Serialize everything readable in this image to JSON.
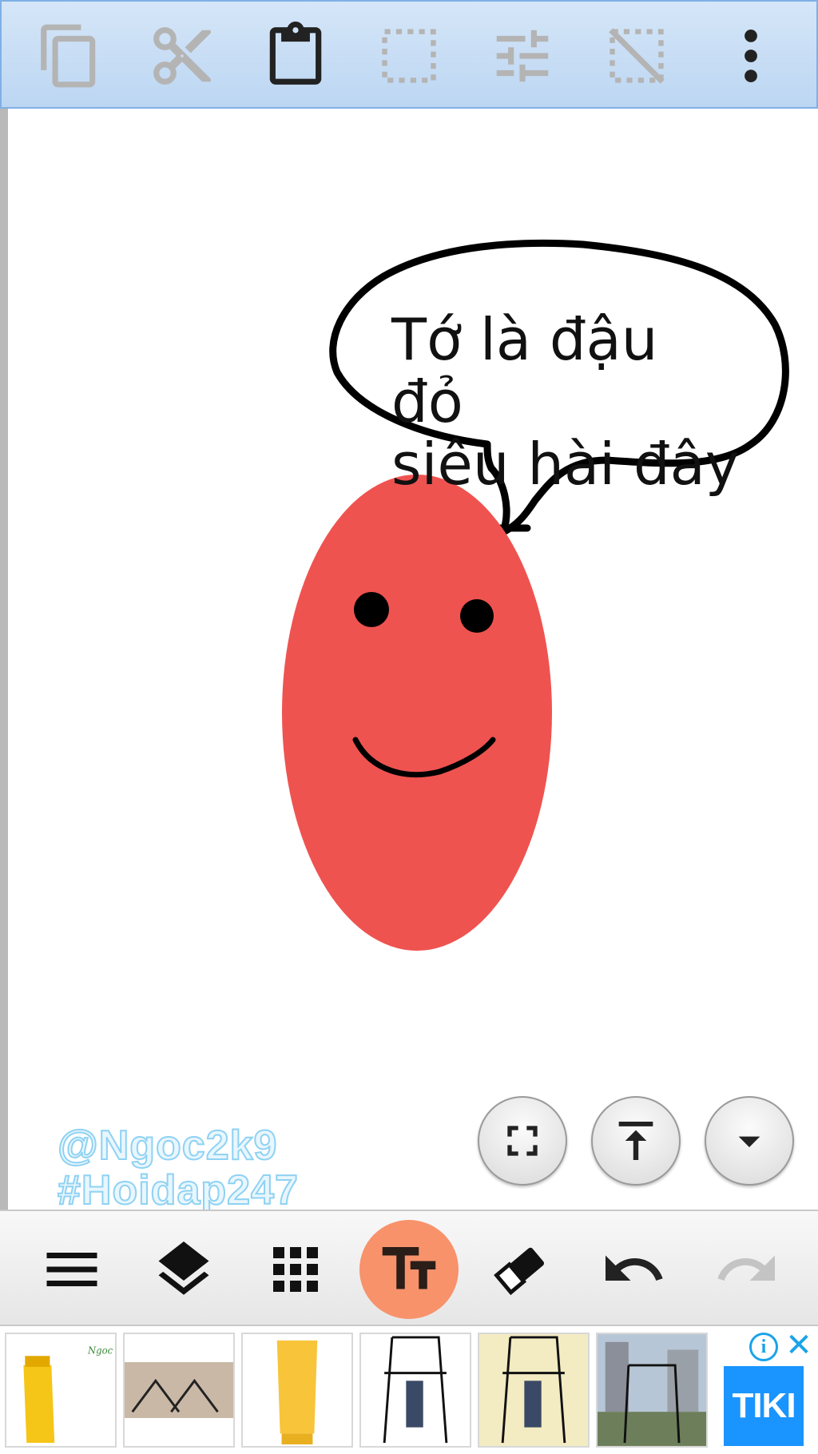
{
  "top_toolbar": {
    "buttons": [
      {
        "name": "copy-icon",
        "enabled": false
      },
      {
        "name": "cut-icon",
        "enabled": false
      },
      {
        "name": "paste-icon",
        "enabled": true
      },
      {
        "name": "select-rect-icon",
        "enabled": false
      },
      {
        "name": "adjust-sliders-icon",
        "enabled": false
      },
      {
        "name": "deselect-icon",
        "enabled": false
      },
      {
        "name": "more-vert-icon",
        "enabled": true
      }
    ],
    "disabled_color": "#b4b4b4",
    "enabled_color": "#222222"
  },
  "canvas": {
    "speech_bubble_text": [
      "Tớ là đậu đỏ",
      "siêu hài đây"
    ],
    "bean_color": "#ef5350",
    "watermark": [
      "@Ngoc2k9",
      "#Hoidap247"
    ]
  },
  "float_buttons": [
    {
      "name": "fullscreen-icon"
    },
    {
      "name": "move-to-top-icon"
    },
    {
      "name": "dropdown-arrow-icon"
    }
  ],
  "bottom_toolbar": {
    "tools": [
      {
        "name": "menu-icon",
        "active": false
      },
      {
        "name": "layers-icon",
        "active": false
      },
      {
        "name": "grid-icon",
        "active": false
      },
      {
        "name": "text-tool-icon",
        "active": true
      },
      {
        "name": "eraser-icon",
        "active": false
      },
      {
        "name": "undo-icon",
        "active": false
      },
      {
        "name": "redo-icon",
        "active": false,
        "enabled": false
      }
    ],
    "active_color": "#f7926b"
  },
  "ad_bar": {
    "info_label": "i",
    "close_label": "✕",
    "advertiser_logo": "TIKI",
    "logo_color": "#1a94ff"
  }
}
